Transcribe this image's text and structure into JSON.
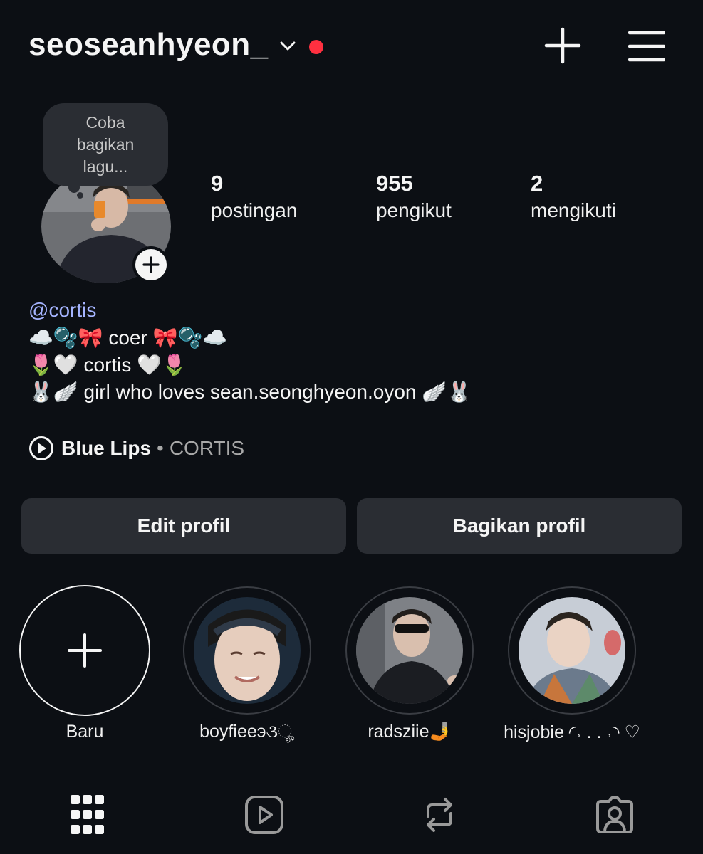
{
  "header": {
    "username": "seoseanhyeon_"
  },
  "note": {
    "text": "Coba bagikan lagu..."
  },
  "stats": [
    {
      "value": "9",
      "label": "postingan"
    },
    {
      "value": "955",
      "label": "pengikut"
    },
    {
      "value": "2",
      "label": "mengikuti"
    }
  ],
  "bio": {
    "threads_handle": "cortis",
    "lines": [
      "☁️🫧🎀 coer 🎀🫧☁️",
      "🌷🤍 cortis 🤍🌷",
      "🐰🪽 girl who loves sean.seonghyeon.oyon 🪽🐰"
    ]
  },
  "music": {
    "song": "Blue Lips",
    "separator": "•",
    "artist": "CORTIS"
  },
  "buttons": {
    "edit": "Edit profil",
    "share": "Bagikan profil"
  },
  "highlights": [
    {
      "label": "Baru"
    },
    {
      "label": "boyfieeэ૩ೄ"
    },
    {
      "label": "radsziie🤳"
    },
    {
      "label": "hisjobie ◜˒ . . ˒◝ ♡"
    }
  ],
  "tabs": [
    "grid-icon",
    "reels-icon",
    "repost-icon",
    "tagged-icon"
  ],
  "colors": {
    "background": "#0c0f14",
    "accent_dot": "#ff3040",
    "button_bg": "#2a2d33",
    "link": "#a5b4ff"
  }
}
